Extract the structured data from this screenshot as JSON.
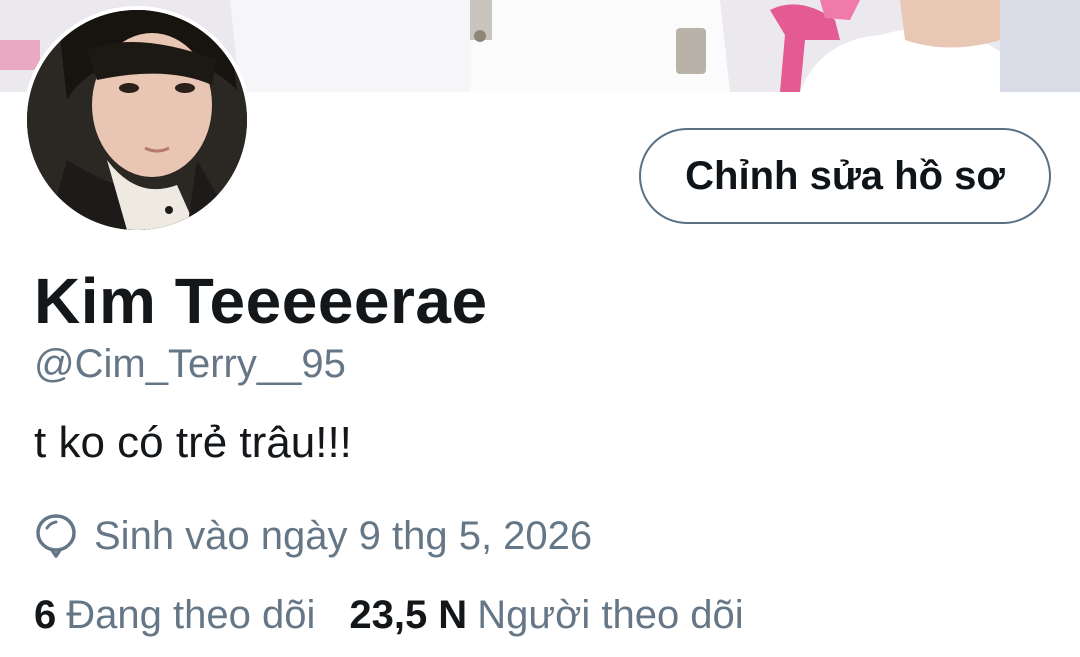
{
  "profile": {
    "display_name": "Kim Teeeeerae",
    "handle": "@Cim_Terry__95",
    "bio": "t ko có trẻ trâu!!!",
    "birthday": "Sinh vào ngày 9 thg 5, 2026",
    "edit_button_label": "Chỉnh sửa hồ sơ"
  },
  "stats": {
    "following_count": "6",
    "following_label": "Đang theo dõi",
    "followers_count": "23,5 N",
    "followers_label": "Người theo dõi"
  },
  "icons": {
    "birthday": "balloon-icon"
  },
  "colors": {
    "primary_text": "#14171a",
    "secondary_text": "#657786",
    "button_border": "#5b7083",
    "background": "#ffffff"
  }
}
